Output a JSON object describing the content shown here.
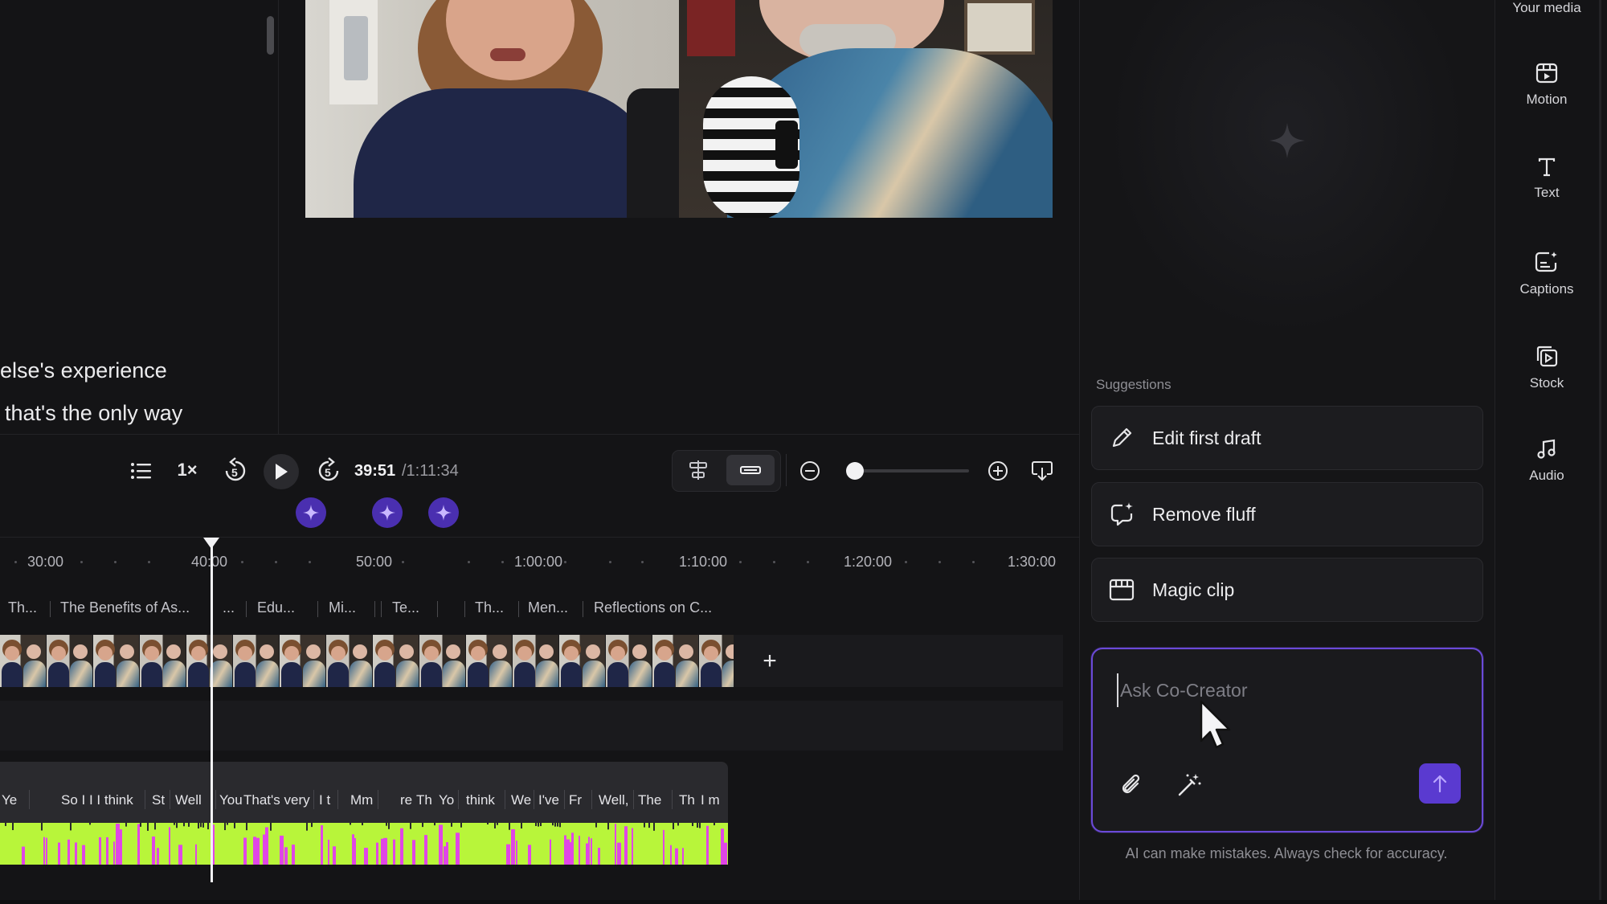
{
  "transcript": {
    "lines": [
      "else's experience",
      "that's the only way"
    ]
  },
  "transport": {
    "speed": "1×",
    "skip_back_seconds": "5",
    "skip_forward_seconds": "5",
    "current_time": "39:51",
    "total_time": "/1:11:34",
    "zoom_level": 0.05
  },
  "timeline": {
    "ruler": [
      "30:00",
      "40:00",
      "50:00",
      "1:00:00",
      "1:10:00",
      "1:20:00",
      "1:30:00"
    ],
    "chapters": [
      "Th...",
      "The Benefits of As...",
      "...",
      "Edu...",
      "Mi...",
      "Te...",
      "Th...",
      "Men...",
      "Reflections on C..."
    ],
    "add_clip": "+",
    "words": [
      "Ye",
      "So I I I think",
      "St",
      "Well",
      "You",
      "That's very",
      "I t",
      "Mm",
      "re",
      "Th",
      "Yo",
      "think",
      "We",
      "I've",
      "Fr",
      "Well,",
      "The",
      "Th",
      "I m"
    ]
  },
  "cocreator": {
    "suggestions_label": "Suggestions",
    "suggestions": [
      {
        "label": "Edit first draft",
        "icon": "pencil-icon"
      },
      {
        "label": "Remove fluff",
        "icon": "sparkle-chat-icon"
      },
      {
        "label": "Magic clip",
        "icon": "calendar-clip-icon"
      }
    ],
    "input_placeholder": "Ask Co-Creator",
    "disclaimer": "AI can make mistakes. Always check for accuracy.",
    "accent_color": "#6b4ad8"
  },
  "rail": {
    "media_label": "Your media",
    "items": [
      {
        "label": "Motion",
        "icon": "motion-icon"
      },
      {
        "label": "Text",
        "icon": "text-icon"
      },
      {
        "label": "Captions",
        "icon": "captions-icon"
      },
      {
        "label": "Stock",
        "icon": "stock-icon"
      },
      {
        "label": "Audio",
        "icon": "audio-icon"
      }
    ]
  },
  "colors": {
    "waveform_primary": "#b8f53a",
    "waveform_secondary": "#e046e6",
    "ai_marker": "#4a2fb0"
  }
}
